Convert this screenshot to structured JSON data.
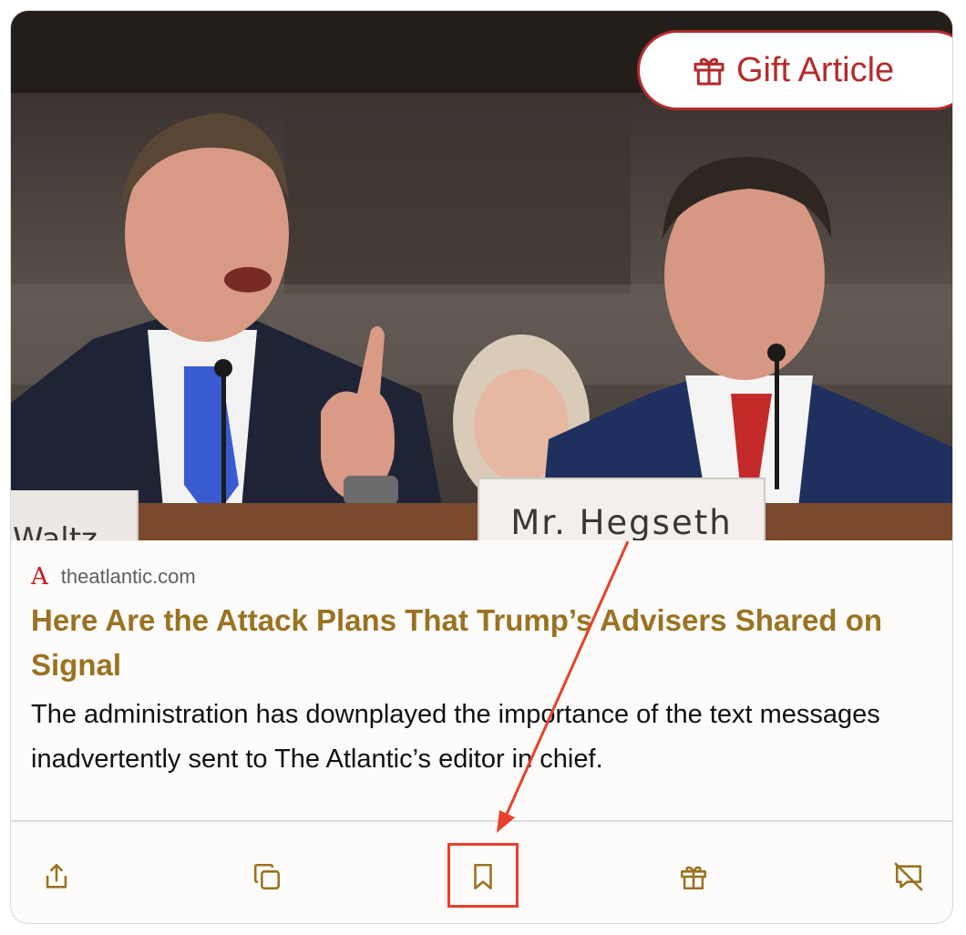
{
  "gift_button": {
    "label": "Gift Article",
    "icon": "gift-icon"
  },
  "hero": {
    "nameplate_main": "Mr. Hegseth",
    "nameplate_left": "Waltz"
  },
  "article": {
    "source_logo": "A",
    "source_domain": "theatlantic.com",
    "headline": "Here Are the Attack Plans That Trump’s Advisers Shared on Signal",
    "dek": "The administration has downplayed the importance of the text messages inadvertently sent to The Atlantic’s editor in chief."
  },
  "actions": [
    {
      "name": "share-icon"
    },
    {
      "name": "copy-icon"
    },
    {
      "name": "bookmark-icon"
    },
    {
      "name": "gift-icon"
    },
    {
      "name": "hide-icon"
    }
  ],
  "colors": {
    "accent_gold": "#9b7222",
    "gift_red": "#b52b2b",
    "annotation_red": "#e8402c"
  }
}
